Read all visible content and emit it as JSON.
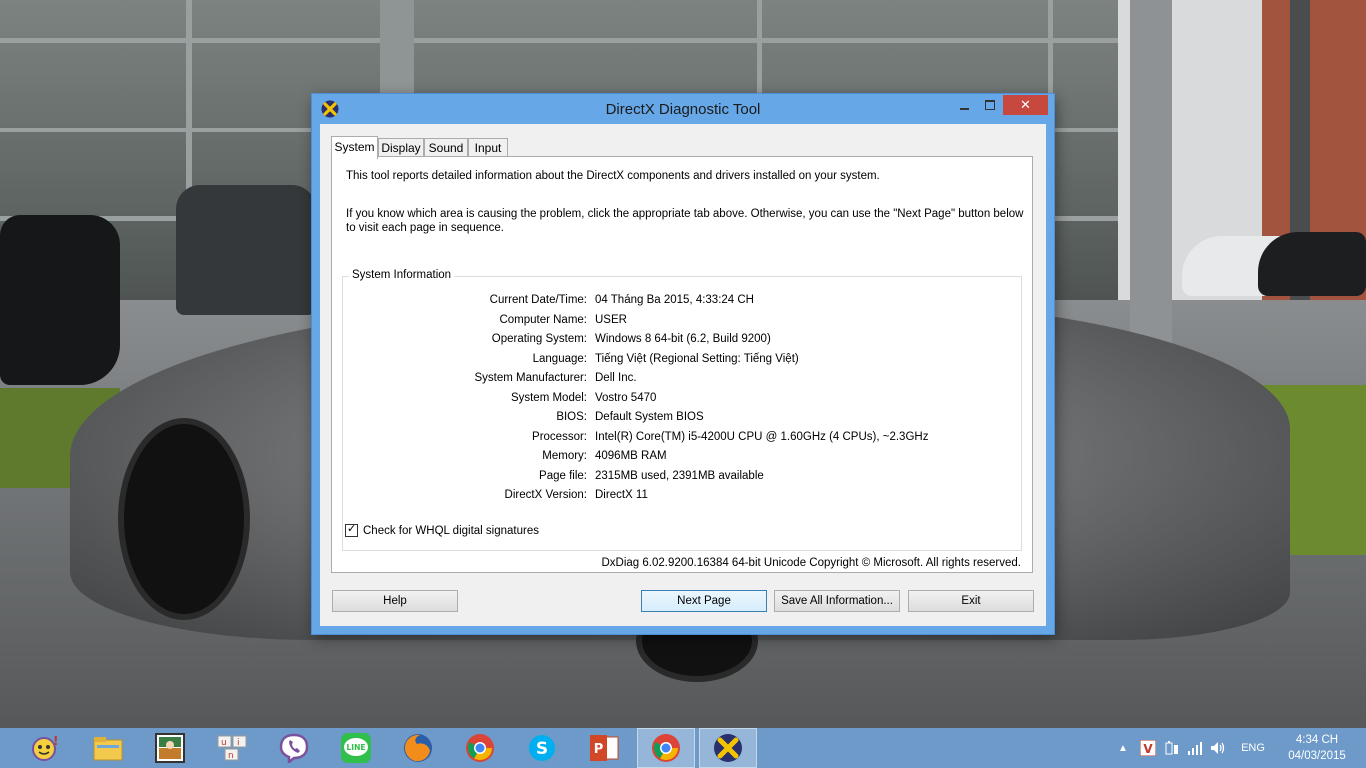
{
  "window": {
    "title": "DirectX Diagnostic Tool",
    "close_glyph": "✕"
  },
  "tabs": [
    {
      "label": "System",
      "active": true
    },
    {
      "label": "Display",
      "active": false
    },
    {
      "label": "Sound",
      "active": false
    },
    {
      "label": "Input",
      "active": false
    }
  ],
  "system_tab": {
    "intro_line1": "This tool reports detailed information about the DirectX components and drivers installed on your system.",
    "intro_line2": "If you know which area is causing the problem, click the appropriate tab above.  Otherwise, you can use the \"Next Page\" button below to visit each page in sequence.",
    "group_title": "System Information",
    "info": [
      {
        "label": "Current Date/Time:",
        "value": "04 Tháng Ba 2015, 4:33:24 CH"
      },
      {
        "label": "Computer Name:",
        "value": "USER"
      },
      {
        "label": "Operating System:",
        "value": "Windows 8 64-bit (6.2, Build 9200)"
      },
      {
        "label": "Language:",
        "value": "Tiếng Việt (Regional Setting: Tiếng Việt)"
      },
      {
        "label": "System Manufacturer:",
        "value": "Dell Inc."
      },
      {
        "label": "System Model:",
        "value": "Vostro 5470"
      },
      {
        "label": "BIOS:",
        "value": "Default System BIOS"
      },
      {
        "label": "Processor:",
        "value": "Intel(R) Core(TM) i5-4200U CPU @ 1.60GHz (4 CPUs), ~2.3GHz"
      },
      {
        "label": "Memory:",
        "value": "4096MB RAM"
      },
      {
        "label": "Page file:",
        "value": "2315MB used, 2391MB available"
      },
      {
        "label": "DirectX Version:",
        "value": "DirectX 11"
      }
    ],
    "whql_checkbox": {
      "label": "Check for WHQL digital signatures",
      "checked": true
    },
    "footer": "DxDiag 6.02.9200.16384 64-bit Unicode  Copyright © Microsoft. All rights reserved."
  },
  "buttons": {
    "help": "Help",
    "next_page": "Next Page",
    "save_all": "Save All Information...",
    "exit": "Exit"
  },
  "taskbar": {
    "apps": [
      "yahoo-messenger-icon",
      "file-explorer-icon",
      "reading-app-icon",
      "unikey-icon",
      "viber-icon",
      "line-icon",
      "firefox-icon",
      "chrome-icon",
      "skype-icon",
      "powerpoint-icon",
      "chrome-icon",
      "directx-icon"
    ],
    "line_label": "LINE",
    "tray_lang": "ENG",
    "clock_time": "4:34 CH",
    "clock_date": "04/03/2015"
  },
  "colors": {
    "window_frame": "#66a7e8",
    "close_button": "#c7483f",
    "taskbar": "#6d9ac9"
  }
}
